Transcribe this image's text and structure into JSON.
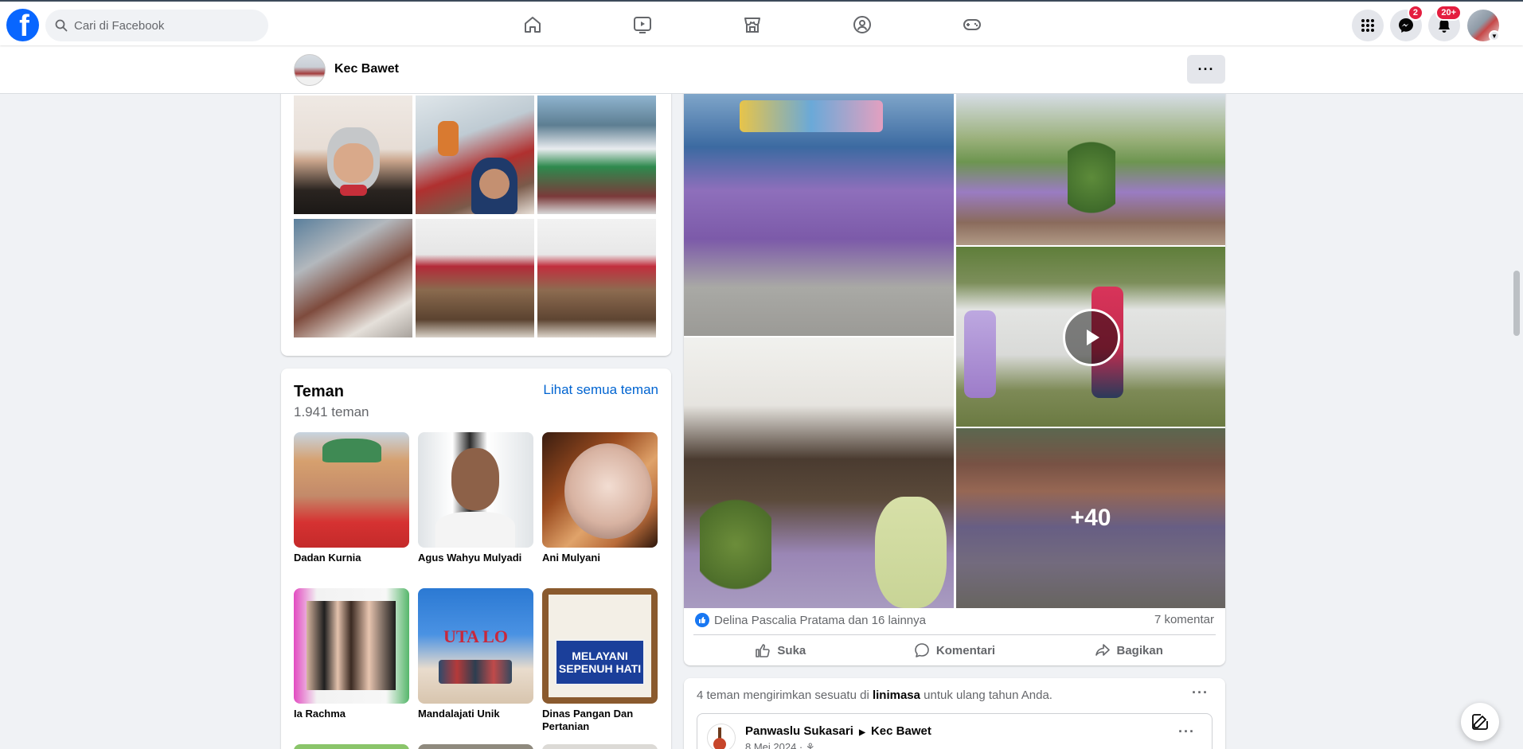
{
  "topnav": {
    "search_placeholder": "Cari di Facebook",
    "messenger_badge": "2",
    "notifications_badge": "20+"
  },
  "profile_header": {
    "name": "Kec Bawet"
  },
  "friends": {
    "title": "Teman",
    "count": "1.941 teman",
    "see_all": "Lihat semua teman",
    "items": [
      {
        "name": "Dadan Kurnia"
      },
      {
        "name": "Agus Wahyu Mulyadi"
      },
      {
        "name": "Ani Mulyani"
      },
      {
        "name": "Ia Rachma"
      },
      {
        "name": "Mandalajati Unik"
      },
      {
        "name": "Dinas Pangan Dan Pertanian"
      }
    ],
    "sign_text_line1": "MELAYANI",
    "sign_text_line2": "SEPENUH HATI",
    "banner_text": "UTA LO"
  },
  "post": {
    "more_photos": "+40",
    "reactions_text": "Delina Pascalia Pratama dan 16 lainnya",
    "comments_text": "7 komentar",
    "like_label": "Suka",
    "comment_label": "Komentari",
    "share_label": "Bagikan"
  },
  "birthday": {
    "text_before": "4 teman mengirimkan sesuatu di",
    "text_link": "linimasa",
    "text_after": "untuk ulang tahun Anda.",
    "inner_from": "Panwaslu Sukasari",
    "inner_to": "Kec Bawet",
    "inner_date": "8 Mei 2024 · ⚘"
  },
  "colors": {
    "brand": "#0866ff",
    "link": "#0064d1",
    "badge": "#e41e3f",
    "background": "#f0f2f5"
  }
}
